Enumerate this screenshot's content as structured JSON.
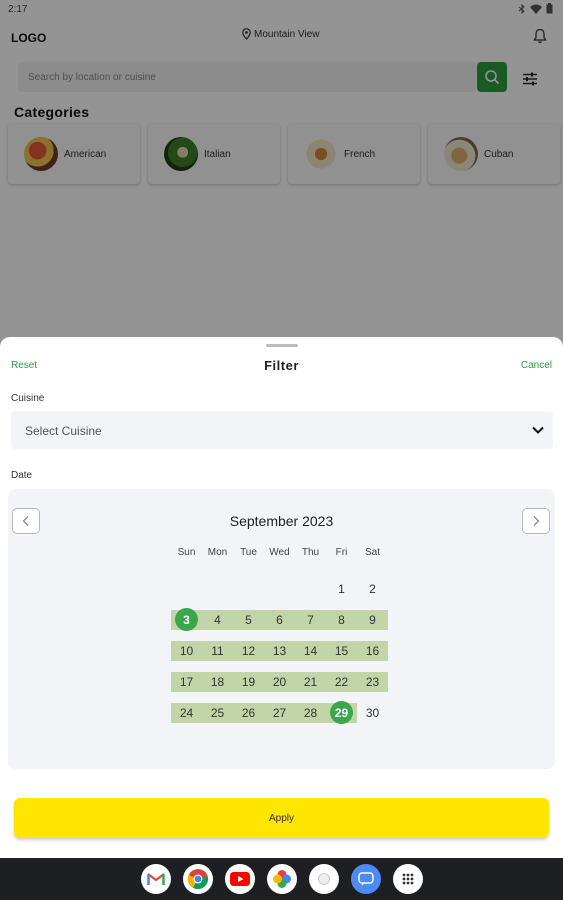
{
  "status_bar": {
    "time": "2:17"
  },
  "header": {
    "logo": "LOGO",
    "location": "Mountain View"
  },
  "search": {
    "placeholder": "Search by location or cuisine"
  },
  "categories": {
    "title": "Categories",
    "items": [
      {
        "label": "American"
      },
      {
        "label": "Italian"
      },
      {
        "label": "French"
      },
      {
        "label": "Cuban"
      }
    ]
  },
  "filter": {
    "reset_label": "Reset",
    "title": "Filter",
    "cancel_label": "Cancel",
    "cuisine_label": "Cuisine",
    "cuisine_value": "Select Cuisine",
    "date_label": "Date",
    "apply_label": "Apply"
  },
  "calendar": {
    "month": "September 2023",
    "weekdays": [
      "Sun",
      "Mon",
      "Tue",
      "Wed",
      "Thu",
      "Fri",
      "Sat"
    ],
    "weeks": [
      [
        "",
        "",
        "",
        "",
        "",
        "1",
        "2"
      ],
      [
        "3",
        "4",
        "5",
        "6",
        "7",
        "8",
        "9"
      ],
      [
        "10",
        "11",
        "12",
        "13",
        "14",
        "15",
        "16"
      ],
      [
        "17",
        "18",
        "19",
        "20",
        "21",
        "22",
        "23"
      ],
      [
        "24",
        "25",
        "26",
        "27",
        "28",
        "29",
        "30"
      ]
    ],
    "range_start": "3",
    "range_end": "29"
  },
  "colors": {
    "accent": "#2e9b3f",
    "range": "#c2d5a8",
    "selected": "#3aa84a",
    "apply": "#ffe600"
  },
  "dock": {
    "apps": [
      "gmail-icon",
      "chrome-icon",
      "youtube-icon",
      "photos-icon",
      "assistant-icon",
      "messages-icon",
      "app-drawer-icon"
    ]
  }
}
